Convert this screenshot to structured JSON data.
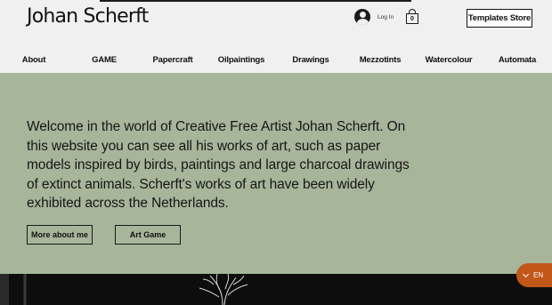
{
  "header": {
    "site_title": "Johan Scherft",
    "login_label": "Log In",
    "cart_count": "0",
    "store_button": "Templates Store"
  },
  "nav": {
    "items": [
      {
        "label": "About"
      },
      {
        "label": "GAME"
      },
      {
        "label": "Papercraft"
      },
      {
        "label": "Oilpaintings"
      },
      {
        "label": "Drawings"
      },
      {
        "label": "Mezzotints"
      },
      {
        "label": "Watercolour"
      },
      {
        "label": "Automata"
      }
    ]
  },
  "hero": {
    "text": "Welcome in the world of Creative Free Artist Johan Scherft. On this website you can see all his works of art, such as paper models inspired by birds, paintings and large charcoal drawings of extinct animals. Scherft's works of art have been widely exhibited across the Netherlands.",
    "button_more": "More about me",
    "button_game": "Art Game",
    "background_color": "#a7b59a"
  },
  "language": {
    "current": "EN",
    "accent_color": "#c2571a"
  },
  "icons": {
    "login": "user-avatar-icon",
    "cart": "shopping-bag-icon",
    "language_toggle": "chevron-down-icon"
  }
}
